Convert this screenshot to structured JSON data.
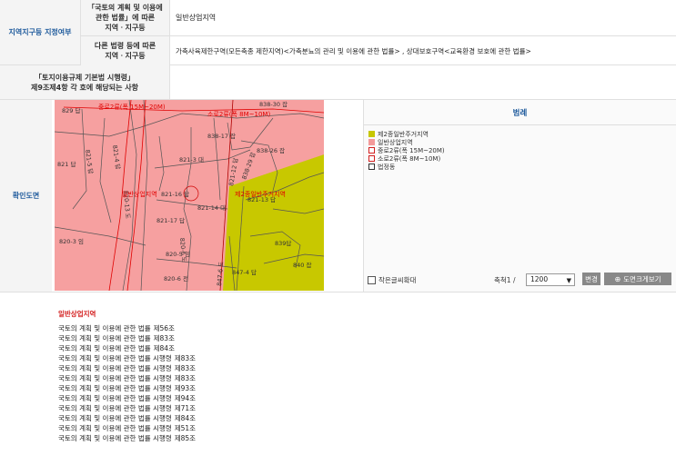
{
  "row1": {
    "label": "지역지구등 지정여부",
    "sub1_label_lines": [
      "「국토의 계획 및 이용에",
      "관한 법률」에 따른",
      "지역ㆍ지구등"
    ],
    "sub1_value": "일반상업지역",
    "sub2_label_lines": [
      "다른 법령 등에 따른",
      "지역ㆍ지구등"
    ],
    "sub2_value": "가축사육제한구역(모든축종 제한지역)<가축분뇨의 관리 및 이용에 관한 법률> , 상대보호구역<교육환경 보호에 관한 법률>"
  },
  "row2": {
    "label_lines": [
      "「토지이용규제 기본법 시행령」",
      "제9조제4항 각 호에 해당되는 사항"
    ],
    "value": ""
  },
  "map_row": {
    "label": "확인도면"
  },
  "map": {
    "lots": [
      "829 답",
      "838-30 잡",
      "838-17 잡",
      "838-26 잡",
      "821-3 대",
      "821 답",
      "821-4 답",
      "821-5 답",
      "838-29 잡",
      "821-16 답",
      "821-14 대",
      "821-13 답",
      "821-17 답",
      "820-3 임",
      "820-5 임",
      "839답",
      "840 잡",
      "847-4 답",
      "820-6 전",
      "820-13 도",
      "821-12 답",
      "847-6 도",
      "820-6 도"
    ],
    "zone_labels": [
      "중로2류(폭 15M~20M)",
      "소로2류(폭 8M~10M)",
      "일반상업지역",
      "제2종일반주거지역"
    ]
  },
  "legend": {
    "title": "범례",
    "items": [
      {
        "label": "제2종일반주거지역",
        "color": "#c7c700",
        "border": "#c7c700"
      },
      {
        "label": "일반상업지역",
        "color": "#f39a9a",
        "border": "#f39a9a"
      },
      {
        "label": "중로2류(폭 15M~20M)",
        "color": "#ffffff",
        "border": "#d32020"
      },
      {
        "label": "소로2류(폭 8M~10M)",
        "color": "#ffffff",
        "border": "#d32020"
      },
      {
        "label": "법정동",
        "color": "#ffffff",
        "border": "#333333"
      }
    ]
  },
  "controls": {
    "enlarge_checkbox_label": "작은글씨확대",
    "scale_label": "축척1 /",
    "scale_value": "1200",
    "change_button": "변경",
    "view_large_button": "도면크게보기"
  },
  "laws": {
    "heading": "일반상업지역",
    "items": [
      {
        "law": "국토의 계획 및 이용에 관한 법률",
        "article": "제56조"
      },
      {
        "law": "국토의 계획 및 이용에 관한 법률",
        "article": "제83조"
      },
      {
        "law": "국토의 계획 및 이용에 관한 법률",
        "article": "제84조"
      },
      {
        "law": "국토의 계획 및 이용에 관한 법률 시행령",
        "article": "제83조"
      },
      {
        "law": "국토의 계획 및 이용에 관한 법률 시행령",
        "article": "제83조"
      },
      {
        "law": "국토의 계획 및 이용에 관한 법률 시행령",
        "article": "제83조"
      },
      {
        "law": "국토의 계획 및 이용에 관한 법률 시행령",
        "article": "제93조"
      },
      {
        "law": "국토의 계획 및 이용에 관한 법률 시행령",
        "article": "제94조"
      },
      {
        "law": "국토의 계획 및 이용에 관한 법률 시행령",
        "article": "제71조"
      },
      {
        "law": "국토의 계획 및 이용에 관한 법률 시행령",
        "article": "제84조"
      },
      {
        "law": "국토의 계획 및 이용에 관한 법률 시행령",
        "article": "제51조"
      },
      {
        "law": "국토의 계획 및 이용에 관한 법률 시행령",
        "article": "제85조"
      }
    ]
  }
}
